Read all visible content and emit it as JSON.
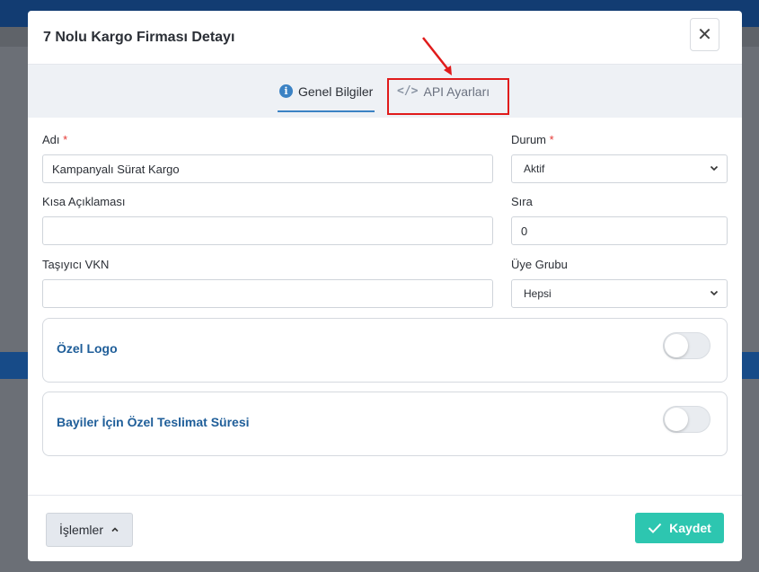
{
  "modal": {
    "title": "7 Nolu Kargo Firması Detayı",
    "close_symbol": "✕"
  },
  "tabs": [
    {
      "label": "Genel Bilgiler",
      "icon": "info-icon",
      "active": true
    },
    {
      "label": "API Ayarları",
      "icon": "code-icon",
      "active": false
    }
  ],
  "form": {
    "adi": {
      "label": "Adı",
      "required": "*",
      "value": "Kampanyalı Sürat Kargo"
    },
    "durum": {
      "label": "Durum",
      "required": "*",
      "value": "Aktif"
    },
    "kisa_aciklama": {
      "label": "Kısa Açıklaması",
      "value": ""
    },
    "sira": {
      "label": "Sıra",
      "value": "0"
    },
    "tasiyici_vkn": {
      "label": "Taşıyıcı VKN",
      "value": ""
    },
    "uye_grubu": {
      "label": "Üye Grubu",
      "value": "Hepsi"
    }
  },
  "toggles": [
    {
      "label": "Özel Logo",
      "enabled": false
    },
    {
      "label": "Bayiler İçin Özel Teslimat Süresi",
      "enabled": false
    }
  ],
  "footer": {
    "actions_label": "İşlemler",
    "save_label": "Kaydet"
  },
  "colors": {
    "accent": "#3b82c4",
    "save": "#2dc6b0",
    "annotation": "#e01b1b",
    "toggle_label": "#1f5e99"
  }
}
